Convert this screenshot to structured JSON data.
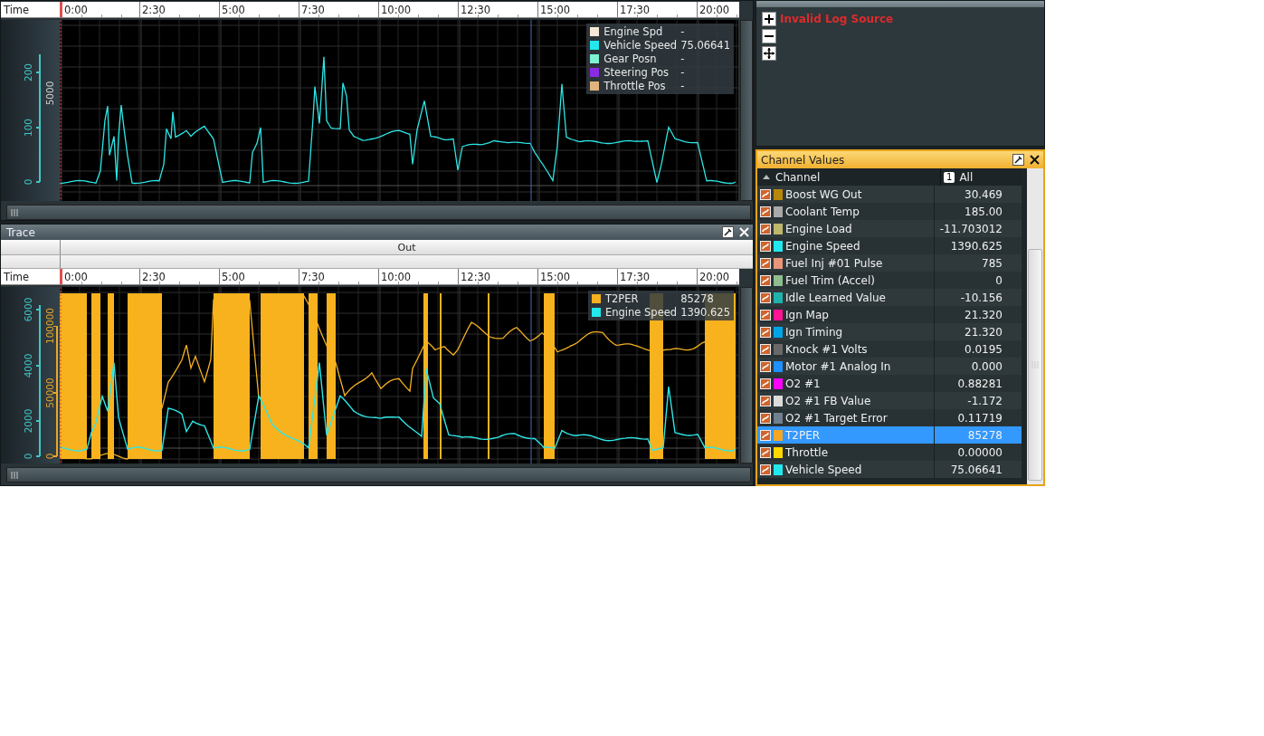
{
  "trace_panels": [
    {
      "time_label": "Time",
      "time_ticks": [
        "0:00",
        "2:30",
        "5:00",
        "7:30",
        "10:00",
        "12:30",
        "15:00",
        "17:30",
        "20:00"
      ],
      "axes": [
        {
          "color": "#3fc8c8",
          "labels": [
            "0",
            "100",
            "200"
          ]
        },
        {
          "color": "#d0d0d0",
          "labels": [
            "5000"
          ]
        }
      ],
      "legend": [
        {
          "name": "Engine Spd",
          "value": "-",
          "color": "#f5e6d6"
        },
        {
          "name": "Vehicle Speed",
          "value": "75.06641",
          "color": "#22e8ee"
        },
        {
          "name": "Gear Posn",
          "value": "-",
          "color": "#7ff2d2"
        },
        {
          "name": "Steering Pos",
          "value": "-",
          "color": "#8a2be2"
        },
        {
          "name": "Throttle Pos",
          "value": "-",
          "color": "#e0b47c"
        }
      ]
    },
    {
      "title": "Trace",
      "header_label": "Out",
      "time_label": "Time",
      "time_ticks": [
        "0:00",
        "2:30",
        "5:00",
        "7:30",
        "10:00",
        "12:30",
        "15:00",
        "17:30",
        "20:00"
      ],
      "axes": [
        {
          "color": "#3fc8c8",
          "labels": [
            "0",
            "2000",
            "4000",
            "6000"
          ]
        },
        {
          "color": "#e8a628",
          "labels": [
            "0",
            "50000",
            "100000"
          ]
        }
      ],
      "legend": [
        {
          "name": "T2PER",
          "value": "85278",
          "color": "#f5b120"
        },
        {
          "name": "Engine Speed",
          "value": "1390.625",
          "color": "#22e8ee"
        }
      ]
    }
  ],
  "dmo_panel": {
    "message": "Invalid Log Source",
    "buttons": [
      {
        "kind": "plus"
      },
      {
        "kind": "minus"
      },
      {
        "kind": "move"
      }
    ]
  },
  "channel_values": {
    "title": "Channel Values",
    "column_name": "Channel",
    "column_value_badge": "1",
    "column_value": "All",
    "rows": [
      {
        "name": "Boost WG Out",
        "value": "30.469",
        "color": "#b8860b",
        "selected": false
      },
      {
        "name": "Coolant Temp",
        "value": "185.00",
        "color": "#a9a9a9",
        "selected": false
      },
      {
        "name": "Engine Load",
        "value": "-11.703012",
        "color": "#bdb76b",
        "selected": false
      },
      {
        "name": "Engine Speed",
        "value": "1390.625",
        "color": "#22e8ee",
        "selected": false
      },
      {
        "name": "Fuel Inj #01 Pulse",
        "value": "785",
        "color": "#e9967a",
        "selected": false
      },
      {
        "name": "Fuel Trim (Accel)",
        "value": "0",
        "color": "#8fbc8f",
        "selected": false
      },
      {
        "name": "Idle Learned Value",
        "value": "-10.156",
        "color": "#20b2aa",
        "selected": false
      },
      {
        "name": "Ign Map",
        "value": "21.320",
        "color": "#ff1493",
        "selected": false
      },
      {
        "name": "Ign Timing",
        "value": "21.320",
        "color": "#00a5e8",
        "selected": false
      },
      {
        "name": "Knock #1 Volts",
        "value": "0.0195",
        "color": "#696969",
        "selected": false
      },
      {
        "name": "Motor #1 Analog In",
        "value": "0.000",
        "color": "#1e90ff",
        "selected": false
      },
      {
        "name": "O2 #1",
        "value": "0.88281",
        "color": "#ff00ff",
        "selected": false
      },
      {
        "name": "O2 #1 FB Value",
        "value": "-1.172",
        "color": "#dcdcdc",
        "selected": false
      },
      {
        "name": "O2 #1 Target Error",
        "value": "0.11719",
        "color": "#708090",
        "selected": false
      },
      {
        "name": "T2PER",
        "value": "85278",
        "color": "#f5a623",
        "selected": true
      },
      {
        "name": "Throttle",
        "value": "0.00000",
        "color": "#ffd700",
        "selected": false
      },
      {
        "name": "Vehicle Speed",
        "value": "75.06641",
        "color": "#22e8ee",
        "selected": false
      }
    ]
  }
}
